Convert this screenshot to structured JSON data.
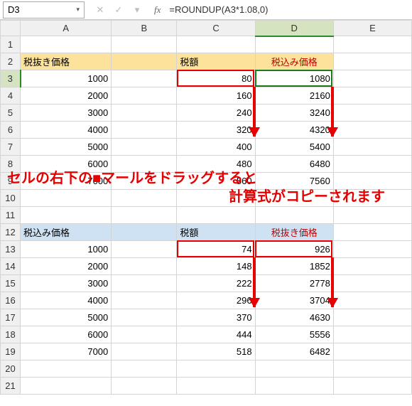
{
  "namebox": {
    "value": "D3",
    "dropdown_icon": "▾"
  },
  "fnbuttons": {
    "cancel": "✕",
    "accept": "✓",
    "wizard": "▾"
  },
  "fx_label": "fx",
  "formula": "=ROUNDUP(A3*1.08,0)",
  "col_headers": [
    "",
    "A",
    "B",
    "C",
    "D",
    "E"
  ],
  "row_headers": [
    "1",
    "2",
    "3",
    "4",
    "5",
    "6",
    "7",
    "8",
    "9",
    "10",
    "11",
    "12",
    "13",
    "14",
    "15",
    "16",
    "17",
    "18",
    "19",
    "20",
    "21"
  ],
  "r2": {
    "a": "税抜き価格",
    "c": "税額",
    "d": "税込み価格"
  },
  "block1": {
    "a": [
      "1000",
      "2000",
      "3000",
      "4000",
      "5000",
      "6000",
      "7000"
    ],
    "c": [
      "80",
      "160",
      "240",
      "320",
      "400",
      "480",
      "560"
    ],
    "d": [
      "1080",
      "2160",
      "3240",
      "4320",
      "5400",
      "6480",
      "7560"
    ]
  },
  "r12": {
    "a": "税込み価格",
    "c": "税額",
    "d": "税抜き価格"
  },
  "block2": {
    "a": [
      "1000",
      "2000",
      "3000",
      "4000",
      "5000",
      "6000",
      "7000"
    ],
    "c": [
      "74",
      "148",
      "222",
      "296",
      "370",
      "444",
      "518"
    ],
    "d": [
      "926",
      "1852",
      "2778",
      "3704",
      "4630",
      "5556",
      "6482"
    ]
  },
  "annotation": {
    "line1": "セルの右下の■マールをドラッグすると",
    "line2": "計算式がコピーされます"
  },
  "chart_data": {
    "type": "table",
    "tables": [
      {
        "title_row": {
          "A": "税抜き価格",
          "C": "税額",
          "D": "税込み価格"
        },
        "rows": [
          {
            "A": 1000,
            "C": 80,
            "D": 1080
          },
          {
            "A": 2000,
            "C": 160,
            "D": 2160
          },
          {
            "A": 3000,
            "C": 240,
            "D": 3240
          },
          {
            "A": 4000,
            "C": 320,
            "D": 4320
          },
          {
            "A": 5000,
            "C": 400,
            "D": 5400
          },
          {
            "A": 6000,
            "C": 480,
            "D": 6480
          },
          {
            "A": 7000,
            "C": 560,
            "D": 7560
          }
        ],
        "formula_D": "=ROUNDUP(A*1.08,0)"
      },
      {
        "title_row": {
          "A": "税込み価格",
          "C": "税額",
          "D": "税抜き価格"
        },
        "rows": [
          {
            "A": 1000,
            "C": 74,
            "D": 926
          },
          {
            "A": 2000,
            "C": 148,
            "D": 1852
          },
          {
            "A": 3000,
            "C": 222,
            "D": 2778
          },
          {
            "A": 4000,
            "C": 296,
            "D": 3704
          },
          {
            "A": 5000,
            "C": 370,
            "D": 4630
          },
          {
            "A": 6000,
            "C": 444,
            "D": 5556
          },
          {
            "A": 7000,
            "C": 518,
            "D": 6482
          }
        ]
      }
    ]
  }
}
